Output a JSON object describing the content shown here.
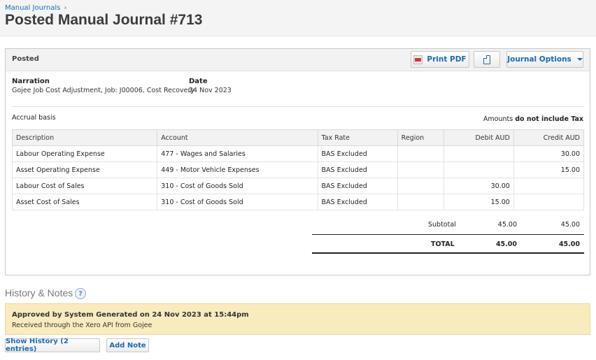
{
  "header": {
    "breadcrumb": "Manual Journals",
    "breadcrumb_sep": "›",
    "title": "Posted Manual Journal #713"
  },
  "panel": {
    "status": "Posted",
    "buttons": {
      "print": "Print PDF",
      "options": "Journal Options"
    },
    "narration_label": "Narration",
    "narration_value": "Gojee Job Cost Adjustment, Job: J00006, Cost Recovery",
    "date_label": "Date",
    "date_value": "24 Nov 2023",
    "basis": "Accrual basis",
    "amounts_prefix": "Amounts",
    "amounts_value": "do not include Tax"
  },
  "table": {
    "columns": [
      "Description",
      "Account",
      "Tax Rate",
      "Region",
      "Debit AUD",
      "Credit AUD"
    ],
    "rows": [
      [
        "Labour Operating Expense",
        "477 - Wages and Salaries",
        "BAS Excluded",
        "",
        "",
        "30.00"
      ],
      [
        "Asset Operating Expense",
        "449 - Motor Vehicle Expenses",
        "BAS Excluded",
        "",
        "",
        "15.00"
      ],
      [
        "Labour Cost of Sales",
        "310 - Cost of Goods Sold",
        "BAS Excluded",
        "",
        "30.00",
        ""
      ],
      [
        "Asset Cost of Sales",
        "310 - Cost of Goods Sold",
        "BAS Excluded",
        "",
        "15.00",
        ""
      ]
    ]
  },
  "totals": {
    "subtotal_label": "Subtotal",
    "subtotal_debit": "45.00",
    "subtotal_credit": "45.00",
    "total_label": "TOTAL",
    "total_debit": "45.00",
    "total_credit": "45.00"
  },
  "history": {
    "title": "History & Notes",
    "help_icon": "?",
    "note_title": "Approved by System Generated on 24 Nov 2023 at 15:44pm",
    "note_text": "Received through the Xero API from Gojee",
    "show_history_button": "Show History (2 entries)",
    "add_note_button": "Add Note"
  }
}
